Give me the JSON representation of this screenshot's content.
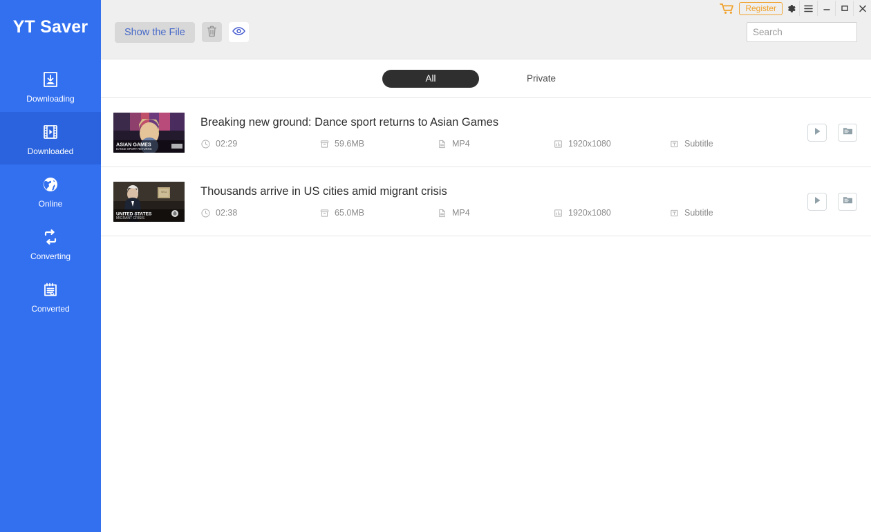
{
  "app": {
    "brand": "YT Saver"
  },
  "titlebar": {
    "cart_icon": "cart-icon",
    "register_label": "Register",
    "settings_icon": "gear-icon",
    "menu_icon": "hamburger-icon",
    "minimize_label": "—",
    "maximize_label": "❐",
    "close_label": "✕"
  },
  "sidebar": {
    "items": [
      {
        "label": "Downloading",
        "icon": "download-box-icon",
        "active": false
      },
      {
        "label": "Downloaded",
        "icon": "film-play-icon",
        "active": true
      },
      {
        "label": "Online",
        "icon": "globe-icon",
        "active": false
      },
      {
        "label": "Converting",
        "icon": "convert-arrows-icon",
        "active": false
      },
      {
        "label": "Converted",
        "icon": "clipboard-refresh-icon",
        "active": false
      }
    ]
  },
  "toolbar": {
    "show_file_label": "Show the File",
    "delete_icon": "trash-icon",
    "preview_icon": "eye-icon"
  },
  "search": {
    "value": "",
    "placeholder": "Search"
  },
  "tabs": [
    {
      "label": "All",
      "active": true
    },
    {
      "label": "Private",
      "active": false
    }
  ],
  "rows": [
    {
      "title": "Breaking new ground: Dance sport returns to Asian Games",
      "duration": "02:29",
      "size": "59.6MB",
      "format": "MP4",
      "resolution": "1920x1080",
      "subtitle": "Subtitle",
      "thumb_caption_line1": "ASIAN GAMES",
      "thumb_caption_line2": "DANCE SPORT RETURNS",
      "play_icon": "play-icon",
      "folder_icon": "folder-icon"
    },
    {
      "title": "Thousands arrive in US cities amid migrant crisis",
      "duration": "02:38",
      "size": "65.0MB",
      "format": "MP4",
      "resolution": "1920x1080",
      "subtitle": "Subtitle",
      "thumb_caption_line1": "UNITED STATES",
      "thumb_caption_line2": "MIGRANT CRISIS",
      "play_icon": "play-icon",
      "folder_icon": "folder-icon"
    }
  ],
  "colors": {
    "sidebar": "#3370f0",
    "sidebar_active": "#2a63dd",
    "accent_orange": "#f0a029",
    "link_blue": "#4668c8",
    "tab_active": "#2f2f2f",
    "toolbar_bg": "#efefef"
  }
}
